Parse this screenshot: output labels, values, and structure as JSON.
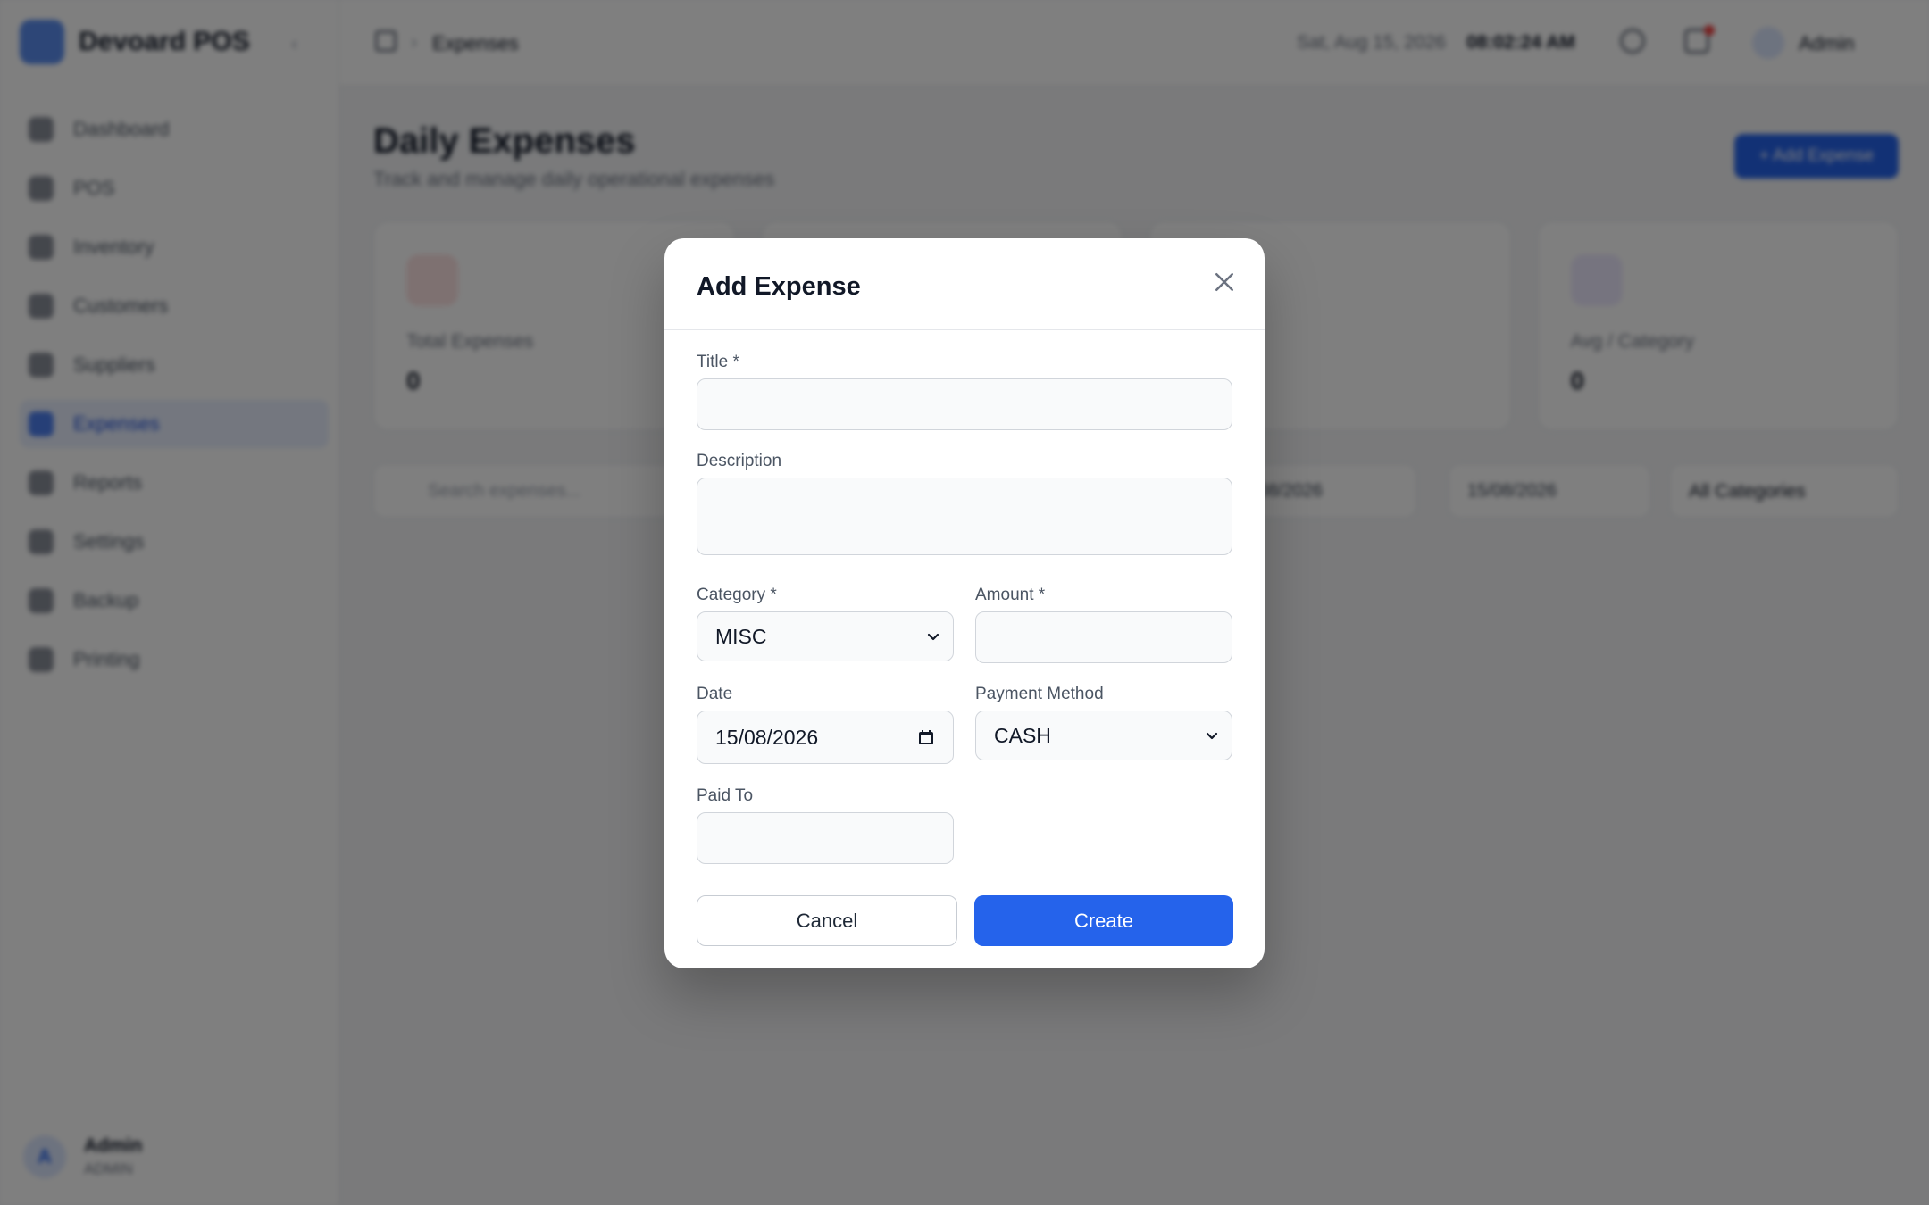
{
  "app": {
    "brand": "Devoard POS",
    "nav": [
      {
        "label": "Dashboard"
      },
      {
        "label": "POS"
      },
      {
        "label": "Inventory"
      },
      {
        "label": "Customers"
      },
      {
        "label": "Suppliers"
      },
      {
        "label": "Expenses"
      },
      {
        "label": "Reports"
      },
      {
        "label": "Settings"
      },
      {
        "label": "Backup"
      },
      {
        "label": "Printing"
      }
    ],
    "user": {
      "initial": "A",
      "name": "Admin",
      "role": "ADMIN"
    }
  },
  "topbar": {
    "breadcrumb_current": "Expenses",
    "date": "Sat, Aug 15, 2026",
    "time": "08:02:24 AM",
    "user_label": "Admin"
  },
  "page": {
    "title": "Daily Expenses",
    "subtitle": "Track and manage daily operational expenses",
    "add_button": "+ Add Expense",
    "stats": [
      {
        "label": "Total Expenses",
        "value": "0",
        "icon_color": "#fde2e2"
      },
      {
        "label": "",
        "value": "",
        "icon_color": "#dbeafe"
      },
      {
        "label": "",
        "value": "",
        "icon_color": "#dcfce7"
      },
      {
        "label": "Avg / Category",
        "value": "0",
        "icon_color": "#ede9fe"
      }
    ],
    "filters": {
      "search_placeholder": "Search expenses...",
      "date_from": "15/08/2026",
      "date_to": "15/08/2026",
      "category": "All Categories"
    }
  },
  "modal": {
    "title": "Add Expense",
    "fields": {
      "title_label": "Title *",
      "title_value": "",
      "description_label": "Description",
      "description_value": "",
      "category_label": "Category *",
      "category_value": "MISC",
      "amount_label": "Amount *",
      "amount_value": "",
      "date_label": "Date",
      "date_value": "15/08/2026",
      "payment_label": "Payment Method",
      "payment_value": "CASH",
      "paid_to_label": "Paid To",
      "paid_to_value": ""
    },
    "cancel_label": "Cancel",
    "create_label": "Create",
    "accent": "#2563eb"
  }
}
